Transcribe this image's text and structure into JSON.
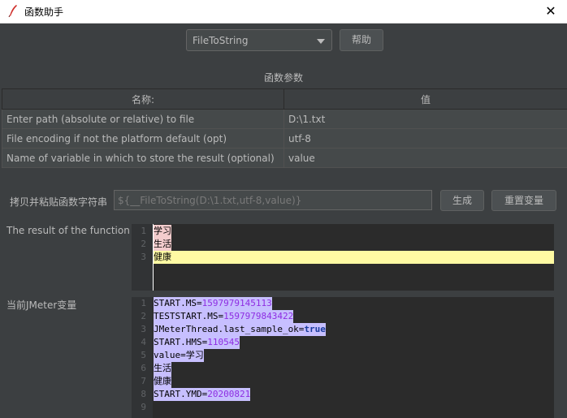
{
  "window": {
    "title": "函数助手",
    "close_glyph": "✕"
  },
  "toolbar": {
    "function_select": "FileToString",
    "help_label": "帮助"
  },
  "params": {
    "section_title": "函数参数",
    "col_name": "名称:",
    "col_value": "值",
    "rows": [
      {
        "name": "Enter path (absolute or relative) to file",
        "value": "D:\\1.txt"
      },
      {
        "name": "File encoding if not the platform default (opt)",
        "value": "utf-8"
      },
      {
        "name": "Name of variable in which to store the result (optional)",
        "value": "value"
      }
    ]
  },
  "copy": {
    "label": "拷贝并粘贴函数字符串",
    "value": "${__FileToString(D:\\1.txt,utf-8,value)}",
    "generate_label": "生成",
    "reset_label": "重置变量"
  },
  "result": {
    "label": "The result of the function is",
    "lines": [
      "学习",
      "生活",
      "健康"
    ],
    "line_numbers": [
      "1",
      "2",
      "3"
    ]
  },
  "vars": {
    "label": "当前JMeter变量",
    "line_numbers": [
      "1",
      "2",
      "3",
      "4",
      "5",
      "6",
      "7",
      "8",
      "9"
    ],
    "lines": [
      {
        "k": "START.MS=",
        "v": "1597979145113"
      },
      {
        "k": "TESTSTART.MS=",
        "v": "1597979843422"
      },
      {
        "k": "JMeterThread.last_sample_ok=",
        "v": "true"
      },
      {
        "k": "START.HMS=",
        "v": "110545"
      },
      {
        "k": "value=",
        "v": "学习"
      },
      {
        "k": "生活",
        "v": ""
      },
      {
        "k": "健康",
        "v": ""
      },
      {
        "k": "START.YMD=",
        "v": "20200821"
      },
      {
        "k": "",
        "v": ""
      }
    ]
  }
}
